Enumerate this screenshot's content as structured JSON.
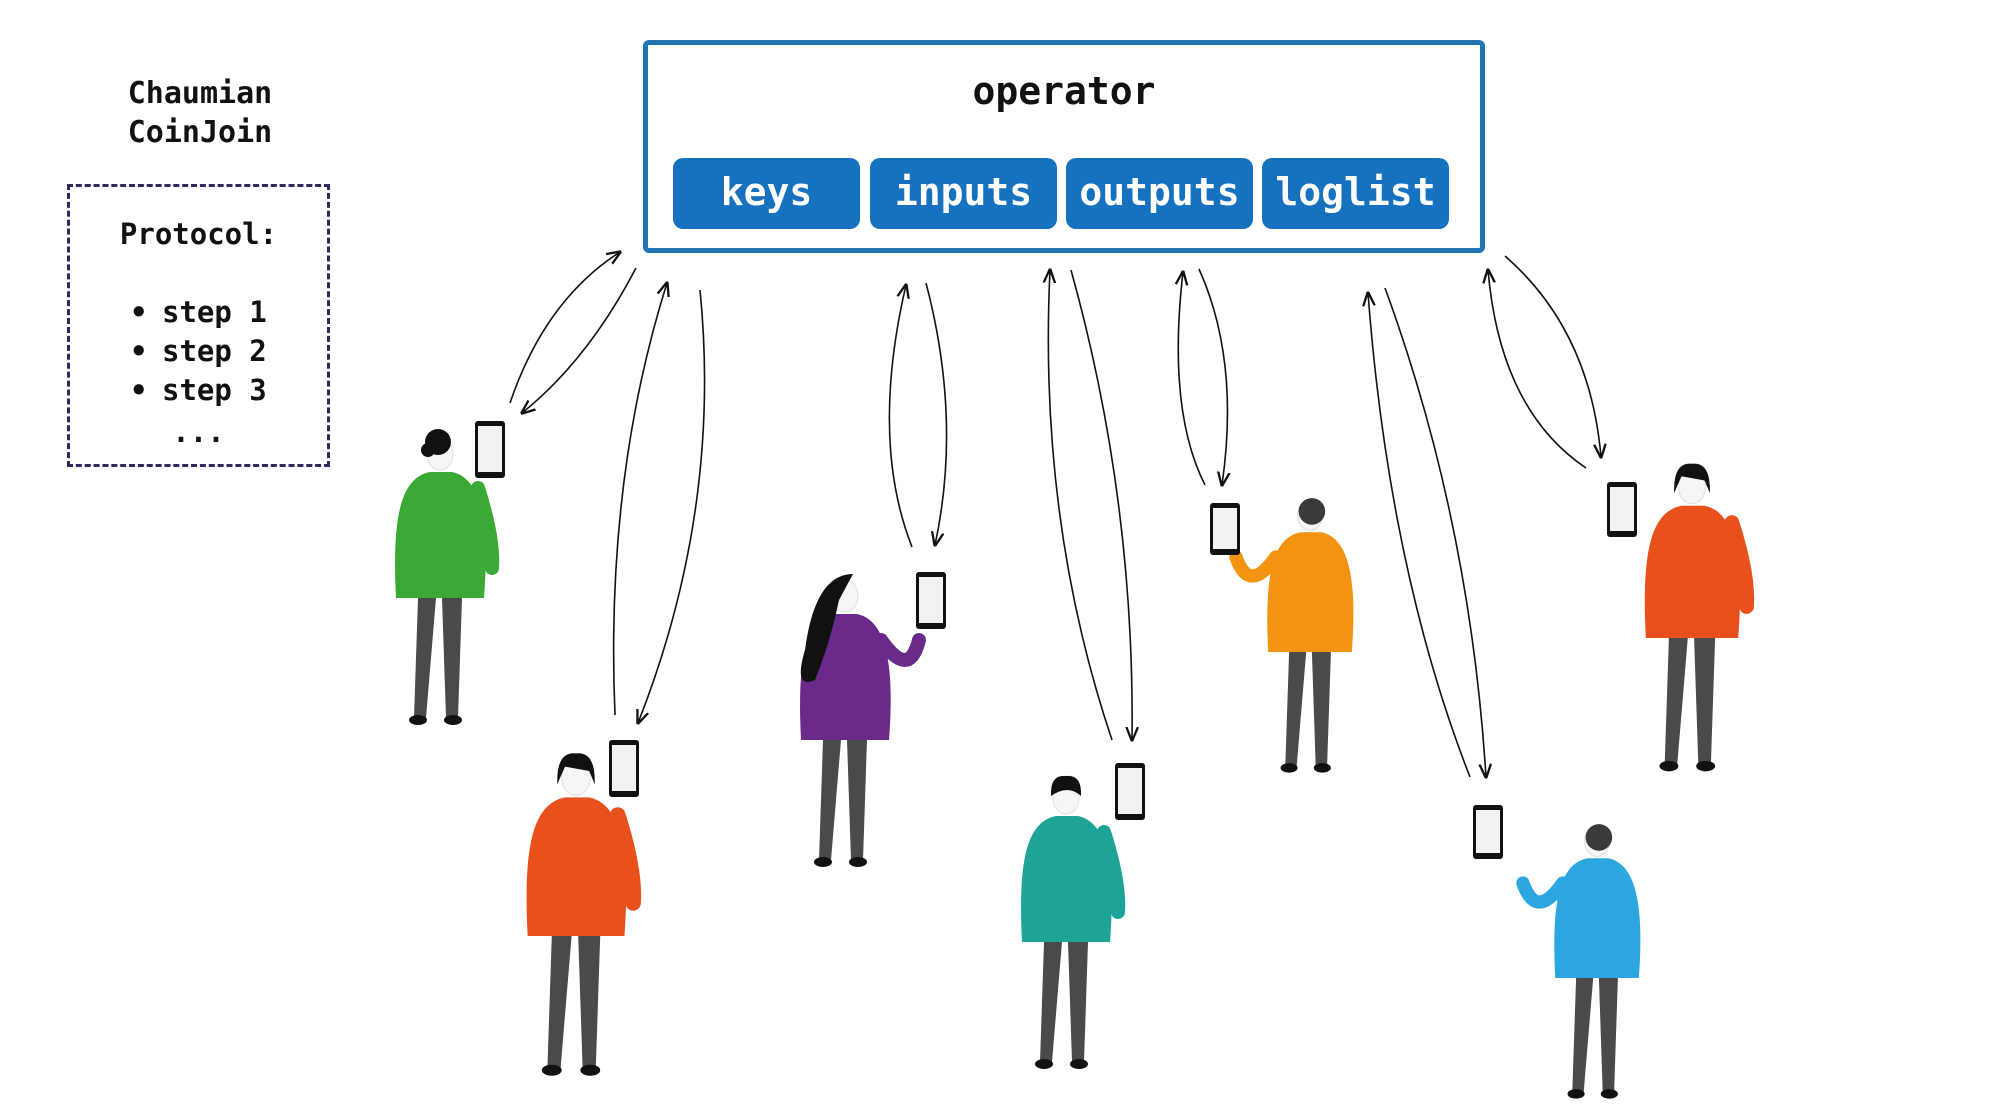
{
  "diagram": {
    "title_line1": "Chaumian",
    "title_line2": "CoinJoin",
    "protocol": {
      "title": "Protocol:",
      "steps": [
        "step 1",
        "step 2",
        "step 3"
      ],
      "more": "..."
    },
    "operator": {
      "title": "operator",
      "components": [
        "keys",
        "inputs",
        "outputs",
        "loglist"
      ]
    },
    "colors": {
      "operator_border": "#1f74b8",
      "component_fill": "#1671be",
      "protocol_border": "#2e2a5c",
      "participant_shirts": [
        "#3aa935",
        "#e8501c",
        "#6a2a8a",
        "#1da497",
        "#f29312",
        "#2ba6e0",
        "#e8501c"
      ]
    },
    "participants": [
      {
        "shirt": "#3aa935",
        "hair": "curly"
      },
      {
        "shirt": "#e8501c",
        "hair": "bob"
      },
      {
        "shirt": "#6a2a8a",
        "hair": "long"
      },
      {
        "shirt": "#1da497",
        "hair": "short"
      },
      {
        "shirt": "#f29312",
        "hair": "back"
      },
      {
        "shirt": "#2ba6e0",
        "hair": "back"
      },
      {
        "shirt": "#e8501c",
        "hair": "bob"
      }
    ]
  }
}
